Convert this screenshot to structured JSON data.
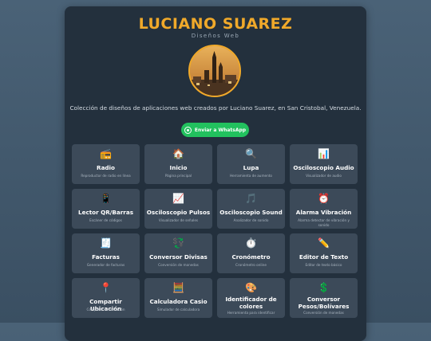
{
  "header": {
    "title": "LUCIANO SUAREZ",
    "subtitle": "Diseños Web",
    "description": "Colección de diseños de aplicaciones web creados por Luciano Suarez, en San Cristobal, Venezuela.",
    "whatsapp_label": "Enviar a WhatsApp"
  },
  "colors": {
    "accent": "#f0a92a",
    "whatsapp": "#22c15e",
    "card": "#23303d",
    "tile": "#3c4a59"
  },
  "apps": [
    {
      "icon": "📻",
      "name": "Radio",
      "desc": "Reproductor de radio en línea"
    },
    {
      "icon": "🏠",
      "name": "Inicio",
      "desc": "Página principal"
    },
    {
      "icon": "🔍",
      "name": "Lupa",
      "desc": "Herramienta de aumento"
    },
    {
      "icon": "📊",
      "name": "Osciloscopio Audio",
      "desc": "Visualizador de audio"
    },
    {
      "icon": "📱",
      "name": "Lector QR/Barras",
      "desc": "Escáner de códigos"
    },
    {
      "icon": "📈",
      "name": "Osciloscopio Pulsos",
      "desc": "Visualizador de señales"
    },
    {
      "icon": "🎵",
      "name": "Osciloscopio Sound",
      "desc": "Analizador de sonido"
    },
    {
      "icon": "⏰",
      "name": "Alarma Vibración",
      "desc": "Alarma detector de vibración y sonido"
    },
    {
      "icon": "🧾",
      "name": "Facturas",
      "desc": "Generador de facturas"
    },
    {
      "icon": "💱",
      "name": "Conversor Divisas",
      "desc": "Conversión de monedas"
    },
    {
      "icon": "⏱️",
      "name": "Cronómetro",
      "desc": "Cronómetro online"
    },
    {
      "icon": "✏️",
      "name": "Editor de Texto",
      "desc": "Editor de texto básico"
    },
    {
      "icon": "📍",
      "name": "Compartir Ubicación",
      "desc": "Compartir tu ubicación"
    },
    {
      "icon": "🧮",
      "name": "Calculadora Casio",
      "desc": "Simulador de calculadora"
    },
    {
      "icon": "🎨",
      "name": "Identificador de colores",
      "desc": "Herramienta para identificar"
    },
    {
      "icon": "💲",
      "name": "Conversor Pesos/Bolívares",
      "desc": "Conversión de monedas"
    }
  ]
}
